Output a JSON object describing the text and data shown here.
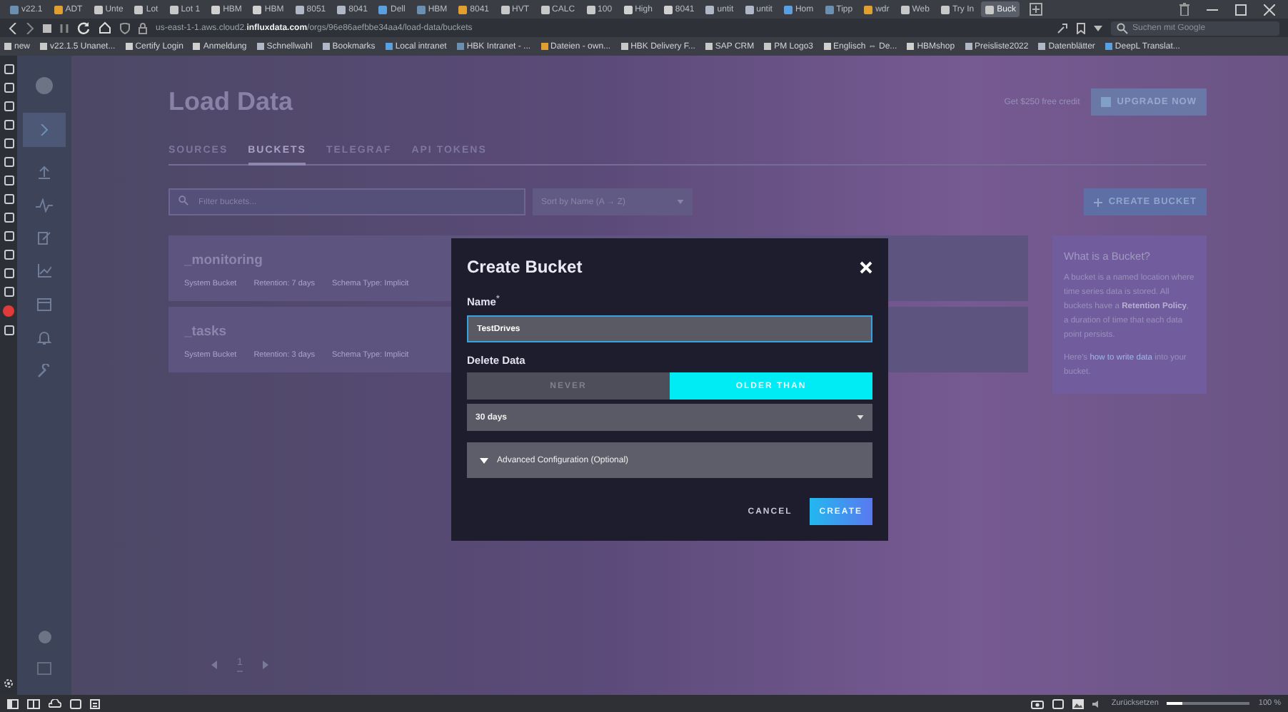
{
  "browser": {
    "tabs": [
      {
        "label": "v22.1",
        "selected": false
      },
      {
        "label": "ADT",
        "selected": false
      },
      {
        "label": "Unte",
        "selected": false
      },
      {
        "label": "Lot",
        "selected": false
      },
      {
        "label": "Lot 1",
        "selected": false
      },
      {
        "label": "HBM",
        "selected": false
      },
      {
        "label": "HBM",
        "selected": false
      },
      {
        "label": "8051",
        "selected": false
      },
      {
        "label": "8041",
        "selected": false
      },
      {
        "label": "Dell",
        "selected": false
      },
      {
        "label": "HBM",
        "selected": false
      },
      {
        "label": "8041",
        "selected": false
      },
      {
        "label": "HVT",
        "selected": false
      },
      {
        "label": "CALC",
        "selected": false
      },
      {
        "label": "100",
        "selected": false
      },
      {
        "label": "High",
        "selected": false
      },
      {
        "label": "8041",
        "selected": false
      },
      {
        "label": "untit",
        "selected": false
      },
      {
        "label": "untit",
        "selected": false
      },
      {
        "label": "Hom",
        "selected": false
      },
      {
        "label": "Tipp",
        "selected": false
      },
      {
        "label": "wdr",
        "selected": false
      },
      {
        "label": "Web",
        "selected": false
      },
      {
        "label": "Try In",
        "selected": false
      },
      {
        "label": "Buck",
        "selected": true
      }
    ],
    "url": "us-east-1-1.aws.cloud2.**influxdata.com**/orgs/96e86aefbbe34aa4/load-data/buckets",
    "search_placeholder": "Suchen mit Google",
    "bookmarks": [
      "new",
      "v22.1.5 Unanet...",
      "Certify Login",
      "Anmeldung",
      "Schnellwahl",
      "Bookmarks",
      "Local intranet",
      "HBK Intranet - ...",
      "Dateien - own...",
      "HBK Delivery F...",
      "SAP CRM",
      "PM Logo3",
      "Englisch ⇔ De...",
      "HBMshop",
      "Preisliste2022",
      "Datenblätter",
      "DeepL Translat..."
    ]
  },
  "app": {
    "title": "Load Data",
    "credit_text": "Get $250 free credit",
    "upgrade_button": "UPGRADE NOW",
    "tabs": [
      {
        "label": "SOURCES",
        "selected": false
      },
      {
        "label": "BUCKETS",
        "selected": true
      },
      {
        "label": "TELEGRAF",
        "selected": false
      },
      {
        "label": "API TOKENS",
        "selected": false
      }
    ],
    "filter_placeholder": "Filter buckets...",
    "sort": "Sort by Name (A → Z)",
    "create_button": "CREATE BUCKET",
    "buckets": [
      {
        "name": "_monitoring",
        "meta": [
          "System Bucket",
          "Retention: 7 days",
          "Schema Type: Implicit"
        ]
      },
      {
        "name": "_tasks",
        "meta": [
          "System Bucket",
          "Retention: 3 days",
          "Schema Type: Implicit"
        ]
      }
    ],
    "info": {
      "title": "What is a Bucket?",
      "text": "A bucket is a named location where time series data is stored. All buckets have a **Retention Policy**, a duration of time that each data point persists.",
      "link_before": "Here's",
      "link": "how to write data",
      "link_after": "into your bucket."
    },
    "pagination": {
      "page": "1"
    }
  },
  "modal": {
    "title": "Create Bucket",
    "name_label": "Name",
    "required_mark": "*",
    "name_value": "TestDrives",
    "delete_label": "Delete Data",
    "delete_options": [
      {
        "label": "NEVER",
        "selected": false
      },
      {
        "label": "OLDER THAN",
        "selected": true
      }
    ],
    "duration": "30 days",
    "advanced": {
      "label": "Advanced Configuration (Optional)",
      "expanded": false
    },
    "buttons": [
      {
        "label": "CANCEL",
        "kind": "secondary"
      },
      {
        "label": "CREATE",
        "kind": "primary"
      }
    ]
  },
  "status_bar": {
    "reset_label": "Zurücksetzen",
    "zoom_slider": {
      "level": 0.18
    },
    "zoom_text": "100 %"
  }
}
